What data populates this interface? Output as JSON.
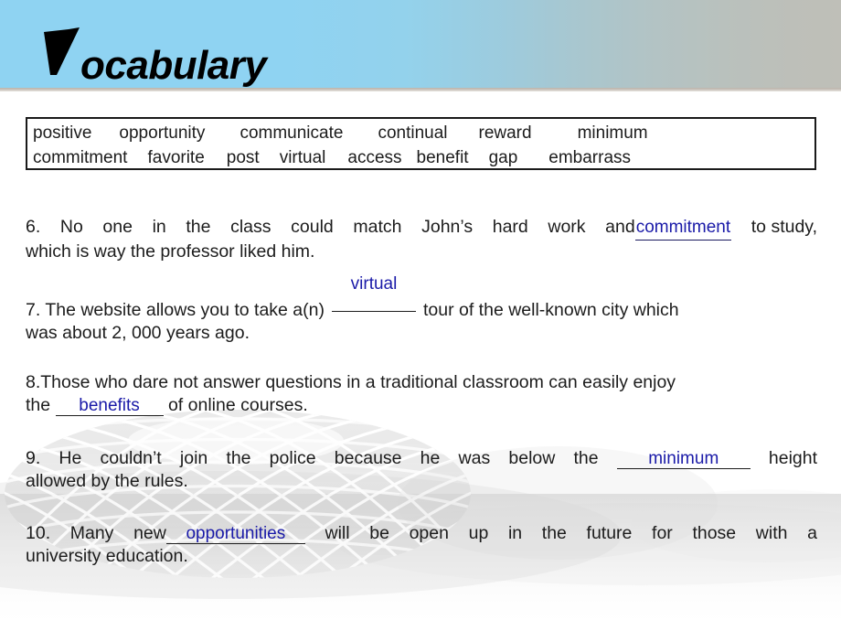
{
  "slide": {
    "title_cap": "V",
    "title_rest": "ocabulary"
  },
  "word_bank": {
    "row1": [
      "positive",
      "opportunity",
      "communicate",
      "continual",
      "reward",
      "minimum"
    ],
    "row2": [
      "commitment",
      "favorite",
      "post",
      "virtual",
      "access",
      "benefit",
      "gap",
      "embarrass"
    ]
  },
  "questions": [
    {
      "number": "6.",
      "line1_a": "6. No one in the class could match John’s hard work and",
      "answer": "commitment",
      "line1_b": "to study,",
      "line2": "which is way the professor liked him."
    },
    {
      "number": "7.",
      "line1_a": "7. The website allows you to take a(n)",
      "answer": "virtual",
      "blank": "__________",
      "line1_b": "tour of the well-known city which",
      "line2": "was about 2, 000 years ago."
    },
    {
      "number": "8.",
      "line1": "8.Those who dare not answer questions in a traditional classroom can easily enjoy",
      "line2_a": "the",
      "answer": "benefits",
      "line2_b": "of online courses."
    },
    {
      "number": "9.",
      "line1_a": "9. He couldn’t join the police because he was below the",
      "answer": "minimum",
      "line1_b": "height",
      "line2": "allowed by the rules."
    },
    {
      "number": "10.",
      "line1_a": "10. Many new",
      "answer": "opportunities",
      "line1_b": "will be open up in the future for those with a",
      "line2": "university education."
    }
  ],
  "colors": {
    "answer_blue": "#1a1aa8",
    "banner_blue": "#8fd3f2",
    "banner_gray": "#bfbfb8",
    "text_black": "#1c1c1c"
  },
  "q6_words": {
    "w1": "6.",
    "w2": "No",
    "w3": "one",
    "w4": "in",
    "w5": "the",
    "w6": "class",
    "w7": "could",
    "w8": "match",
    "w9": "John’s",
    "w10": "hard",
    "w11": "work",
    "w12": "and",
    "tail": "to study,"
  },
  "q7_words": {
    "head": "7. The website allows you to take a(n)",
    "tail": "tour of the well-known city which"
  },
  "q9_words": {
    "w1": "9.",
    "w2": "He",
    "w3": "couldn’t",
    "w4": "join",
    "w5": "the",
    "w6": "police",
    "w7": "because",
    "w8": "he",
    "w9": "was",
    "w10": "below",
    "w11": "the",
    "tail": "height"
  },
  "q10_words": {
    "w1": "10.",
    "w2": "Many",
    "w3": "new",
    "t1": "will",
    "t2": "be",
    "t3": "open",
    "t4": "up",
    "t5": "in",
    "t6": "the",
    "t7": "future",
    "t8": "for",
    "t9": "those",
    "t10": "with",
    "t11": "a"
  }
}
